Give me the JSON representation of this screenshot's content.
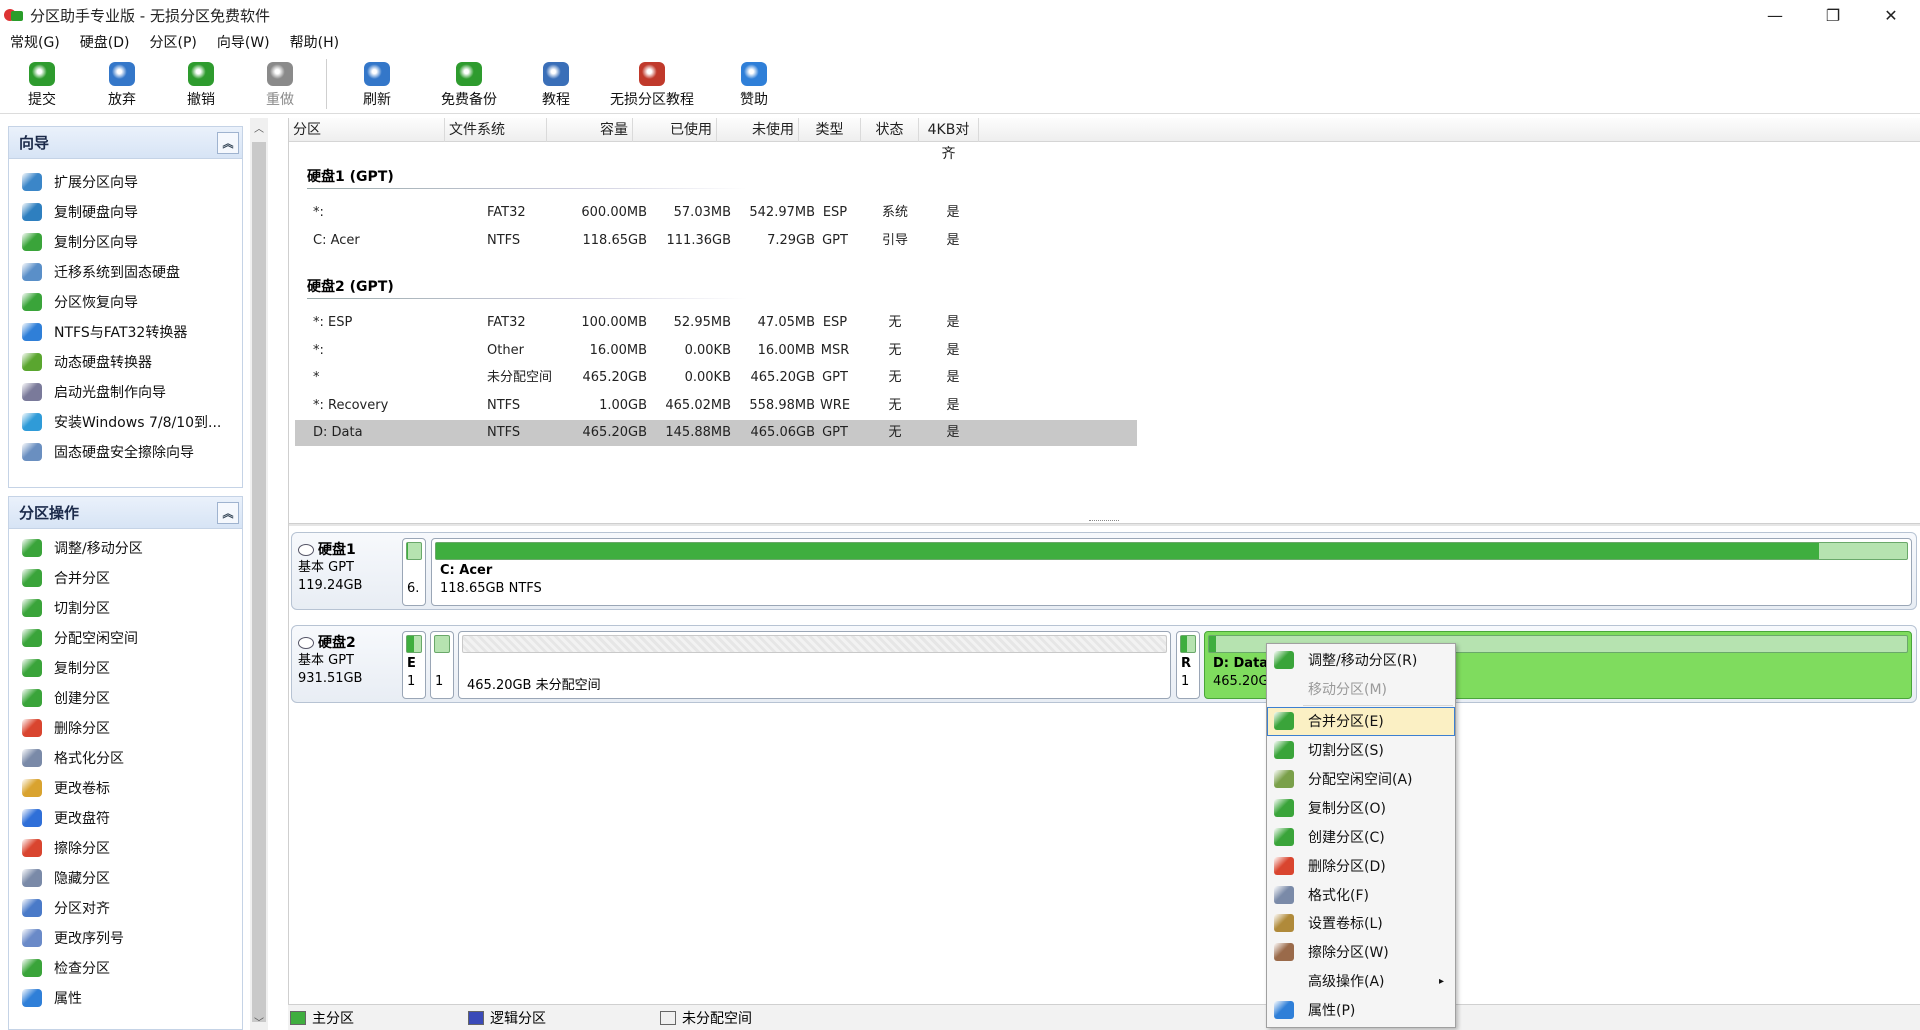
{
  "window": {
    "title": "分区助手专业版 - 无损分区免费软件",
    "minimize": "—",
    "restore": "❐",
    "close": "✕"
  },
  "menu": [
    "常规(G)",
    "硬盘(D)",
    "分区(P)",
    "向导(W)",
    "帮助(H)"
  ],
  "toolbar": [
    {
      "label": "提交",
      "icon": "check-icon",
      "color": "#2e9b2e"
    },
    {
      "label": "放弃",
      "icon": "discard-icon",
      "color": "#3477c9"
    },
    {
      "label": "撤销",
      "icon": "undo-icon",
      "color": "#2e9b2e"
    },
    {
      "label": "重做",
      "icon": "redo-icon",
      "color": "#8a8a8a",
      "disabled": true
    },
    {
      "label": "刷新",
      "icon": "refresh-icon",
      "color": "#3477c9"
    },
    {
      "label": "免费备份",
      "icon": "backup-icon",
      "color": "#2e9b2e"
    },
    {
      "label": "教程",
      "icon": "tutorial-icon",
      "color": "#3a6fb8"
    },
    {
      "label": "无损分区教程",
      "icon": "partition-tutorial-icon",
      "color": "#c0392b"
    },
    {
      "label": "赞助",
      "icon": "heart-icon",
      "color": "#2f7fd8"
    }
  ],
  "sidebar": {
    "wizard": {
      "title": "向导",
      "items": [
        {
          "label": "扩展分区向导",
          "icon": "extend-wizard-icon",
          "color": "#3b86c8"
        },
        {
          "label": "复制硬盘向导",
          "icon": "copy-disk-icon",
          "color": "#2e7fbf"
        },
        {
          "label": "复制分区向导",
          "icon": "copy-partition-icon",
          "color": "#3aa43a"
        },
        {
          "label": "迁移系统到固态硬盘",
          "icon": "migrate-ssd-icon",
          "color": "#5a8fc8"
        },
        {
          "label": "分区恢复向导",
          "icon": "recovery-icon",
          "color": "#3aa43a"
        },
        {
          "label": "NTFS与FAT32转换器",
          "icon": "convert-icon",
          "color": "#2f7fd8"
        },
        {
          "label": "动态硬盘转换器",
          "icon": "dynamic-disk-icon",
          "color": "#5aa62f"
        },
        {
          "label": "启动光盘制作向导",
          "icon": "bootable-cd-icon",
          "color": "#7a7a9a"
        },
        {
          "label": "安装Windows 7/8/10到...",
          "icon": "windows-icon",
          "color": "#2f9bd8"
        },
        {
          "label": "固态硬盘安全擦除向导",
          "icon": "ssd-erase-icon",
          "color": "#6a8fc0"
        }
      ]
    },
    "operations": {
      "title": "分区操作",
      "items": [
        {
          "label": "调整/移动分区",
          "icon": "resize-icon",
          "color": "#3aa43a"
        },
        {
          "label": "合并分区",
          "icon": "merge-icon",
          "color": "#3aa43a"
        },
        {
          "label": "切割分区",
          "icon": "split-icon",
          "color": "#3aa43a"
        },
        {
          "label": "分配空闲空间",
          "icon": "allocate-icon",
          "color": "#3aa43a"
        },
        {
          "label": "复制分区",
          "icon": "copy-icon",
          "color": "#3aa43a"
        },
        {
          "label": "创建分区",
          "icon": "create-icon",
          "color": "#3aa43a"
        },
        {
          "label": "删除分区",
          "icon": "delete-icon",
          "color": "#d9452f"
        },
        {
          "label": "格式化分区",
          "icon": "format-icon",
          "color": "#7a8aa8"
        },
        {
          "label": "更改卷标",
          "icon": "label-icon",
          "color": "#d9a32f"
        },
        {
          "label": "更改盘符",
          "icon": "drive-letter-icon",
          "color": "#2f6fd8"
        },
        {
          "label": "擦除分区",
          "icon": "wipe-icon",
          "color": "#d9452f"
        },
        {
          "label": "隐藏分区",
          "icon": "hide-icon",
          "color": "#7a8aa8"
        },
        {
          "label": "分区对齐",
          "icon": "align-icon",
          "color": "#4a7ac8"
        },
        {
          "label": "更改序列号",
          "icon": "serial-icon",
          "color": "#6a8ac8"
        },
        {
          "label": "检查分区",
          "icon": "check-partition-icon",
          "color": "#3aa43a"
        },
        {
          "label": "属性",
          "icon": "properties-icon",
          "color": "#2f7fd8"
        }
      ]
    }
  },
  "table": {
    "headers": [
      "分区",
      "文件系统",
      "容量",
      "已使用",
      "未使用",
      "类型",
      "状态",
      "4KB对齐"
    ],
    "disks": [
      {
        "title": "硬盘1 (GPT)",
        "rows": [
          {
            "name": "*:",
            "fs": "FAT32",
            "cap": "600.00MB",
            "used": "57.03MB",
            "free": "542.97MB",
            "type": "ESP",
            "status": "系统",
            "align": "是"
          },
          {
            "name": "C: Acer",
            "fs": "NTFS",
            "cap": "118.65GB",
            "used": "111.36GB",
            "free": "7.29GB",
            "type": "GPT",
            "status": "引导",
            "align": "是"
          }
        ]
      },
      {
        "title": "硬盘2 (GPT)",
        "rows": [
          {
            "name": "*: ESP",
            "fs": "FAT32",
            "cap": "100.00MB",
            "used": "52.95MB",
            "free": "47.05MB",
            "type": "ESP",
            "status": "无",
            "align": "是"
          },
          {
            "name": "*:",
            "fs": "Other",
            "cap": "16.00MB",
            "used": "0.00KB",
            "free": "16.00MB",
            "type": "MSR",
            "status": "无",
            "align": "是"
          },
          {
            "name": "*",
            "fs": "未分配空间",
            "cap": "465.20GB",
            "used": "0.00KB",
            "free": "465.20GB",
            "type": "GPT",
            "status": "无",
            "align": "是"
          },
          {
            "name": "*: Recovery",
            "fs": "NTFS",
            "cap": "1.00GB",
            "used": "465.02MB",
            "free": "558.98MB",
            "type": "WRE",
            "status": "无",
            "align": "是"
          },
          {
            "name": "D: Data",
            "fs": "NTFS",
            "cap": "465.20GB",
            "used": "145.88MB",
            "free": "465.06GB",
            "type": "GPT",
            "status": "无",
            "align": "是",
            "selected": true
          }
        ]
      }
    ]
  },
  "diskmap": {
    "disk1": {
      "name": "硬盘1",
      "type": "基本 GPT",
      "size": "119.24GB",
      "segments": [
        {
          "t1": "",
          "t2": "6.",
          "used_fraction": 0.1
        },
        {
          "t1": "C: Acer",
          "t2": "118.65GB NTFS",
          "used_fraction": 0.94
        }
      ]
    },
    "disk2": {
      "name": "硬盘2",
      "type": "基本 GPT",
      "size": "931.51GB",
      "segments": [
        {
          "t1": "E",
          "t2": "1",
          "used_fraction": 0.5
        },
        {
          "t1": "",
          "t2": "1",
          "used_fraction": 0
        },
        {
          "t1": "",
          "t2": "465.20GB 未分配空间",
          "used_fraction": 0,
          "unallocated": true
        },
        {
          "t1": "R",
          "t2": "1",
          "used_fraction": 0.45
        },
        {
          "t1": "D: Data",
          "t2": "465.20GB",
          "used_fraction": 0.01,
          "selected": true
        }
      ]
    }
  },
  "legend": [
    {
      "label": "主分区",
      "color": "#3fae3f"
    },
    {
      "label": "逻辑分区",
      "color": "#3a4ab8"
    },
    {
      "label": "未分配空间",
      "color": "#f0f0f0"
    }
  ],
  "context_menu": [
    {
      "label": "调整/移动分区(R)",
      "icon": "resize-icon",
      "color": "#3aa43a"
    },
    {
      "label": "移动分区(M)",
      "disabled": true
    },
    {
      "sep": true
    },
    {
      "label": "合并分区(E)",
      "icon": "merge-icon",
      "color": "#3aa43a",
      "highlighted": true
    },
    {
      "label": "切割分区(S)",
      "icon": "split-icon",
      "color": "#3aa43a"
    },
    {
      "label": "分配空闲空间(A)",
      "icon": "allocate-icon",
      "color": "#7aa04a"
    },
    {
      "label": "复制分区(O)",
      "icon": "copy-icon",
      "color": "#3aa43a"
    },
    {
      "label": "创建分区(C)",
      "icon": "create-icon",
      "color": "#3aa43a"
    },
    {
      "label": "删除分区(D)",
      "icon": "delete-icon",
      "color": "#d9452f"
    },
    {
      "label": "格式化(F)",
      "icon": "format-icon",
      "color": "#7a8aa8"
    },
    {
      "label": "设置卷标(L)",
      "icon": "label-icon",
      "color": "#b08a3a"
    },
    {
      "label": "擦除分区(W)",
      "icon": "wipe-icon",
      "color": "#9a6a4a"
    },
    {
      "label": "高级操作(A)",
      "submenu": true,
      "arrow": "▸"
    },
    {
      "label": "属性(P)",
      "icon": "properties-icon",
      "color": "#2f7fd8"
    }
  ]
}
